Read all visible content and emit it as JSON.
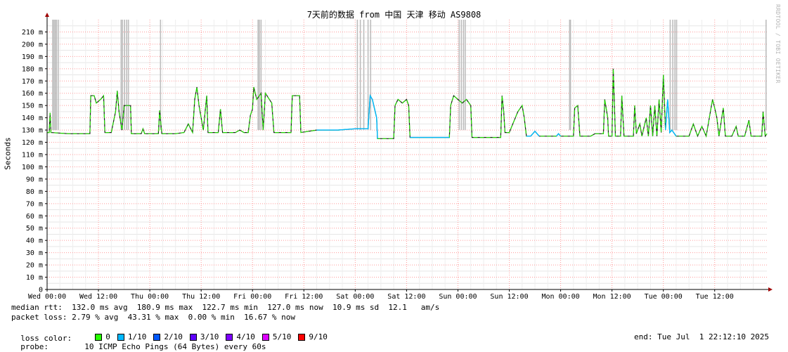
{
  "title": "7天前的数据 from 中国 天津 移动 AS9808",
  "watermark": "RRDTOOL / TOBI OETIKER",
  "chart_data": {
    "type": "line",
    "title": "7天前的数据 from 中国 天津 移动 AS9808",
    "ylabel": "Seconds",
    "ylim": [
      0,
      220
    ],
    "yticks": [
      {
        "v": 0,
        "label": "0"
      },
      {
        "v": 10,
        "label": "10 m"
      },
      {
        "v": 20,
        "label": "20 m"
      },
      {
        "v": 30,
        "label": "30 m"
      },
      {
        "v": 40,
        "label": "40 m"
      },
      {
        "v": 50,
        "label": "50 m"
      },
      {
        "v": 60,
        "label": "60 m"
      },
      {
        "v": 70,
        "label": "70 m"
      },
      {
        "v": 80,
        "label": "80 m"
      },
      {
        "v": 90,
        "label": "90 m"
      },
      {
        "v": 100,
        "label": "100 m"
      },
      {
        "v": 110,
        "label": "110 m"
      },
      {
        "v": 120,
        "label": "120 m"
      },
      {
        "v": 130,
        "label": "130 m"
      },
      {
        "v": 140,
        "label": "140 m"
      },
      {
        "v": 150,
        "label": "150 m"
      },
      {
        "v": 160,
        "label": "160 m"
      },
      {
        "v": 170,
        "label": "170 m"
      },
      {
        "v": 180,
        "label": "180 m"
      },
      {
        "v": 190,
        "label": "190 m"
      },
      {
        "v": 200,
        "label": "200 m"
      },
      {
        "v": 210,
        "label": "210 m"
      }
    ],
    "xlim": [
      0,
      168.2
    ],
    "xticks": [
      {
        "h": 0,
        "label": "Wed 00:00"
      },
      {
        "h": 12,
        "label": "Wed 12:00"
      },
      {
        "h": 24,
        "label": "Thu 00:00"
      },
      {
        "h": 36,
        "label": "Thu 12:00"
      },
      {
        "h": 48,
        "label": "Fri 00:00"
      },
      {
        "h": 60,
        "label": "Fri 12:00"
      },
      {
        "h": 72,
        "label": "Sat 00:00"
      },
      {
        "h": 84,
        "label": "Sat 12:00"
      },
      {
        "h": 96,
        "label": "Sun 00:00"
      },
      {
        "h": 108,
        "label": "Sun 12:00"
      },
      {
        "h": 120,
        "label": "Mon 00:00"
      },
      {
        "h": 132,
        "label": "Mon 12:00"
      },
      {
        "h": 144,
        "label": "Tue 00:00"
      },
      {
        "h": 156,
        "label": "Tue 12:00"
      }
    ],
    "median_rtt": [
      [
        0,
        128
      ],
      [
        0.5,
        128
      ],
      [
        0.7,
        144
      ],
      [
        0.9,
        128
      ],
      [
        5,
        127
      ],
      [
        10,
        127
      ],
      [
        10.2,
        158
      ],
      [
        11,
        158
      ],
      [
        11.5,
        152
      ],
      [
        12.5,
        155
      ],
      [
        13.2,
        158
      ],
      [
        13.5,
        128
      ],
      [
        15,
        128
      ],
      [
        16,
        145
      ],
      [
        16.4,
        162
      ],
      [
        16.8,
        145
      ],
      [
        17.5,
        130
      ],
      [
        18,
        150
      ],
      [
        19.5,
        150
      ],
      [
        19.7,
        127
      ],
      [
        22,
        127
      ],
      [
        22.4,
        131
      ],
      [
        22.8,
        127
      ],
      [
        26,
        127
      ],
      [
        26.3,
        146
      ],
      [
        26.8,
        127
      ],
      [
        30,
        127
      ],
      [
        32,
        128
      ],
      [
        33,
        135
      ],
      [
        34,
        128
      ],
      [
        34.5,
        155
      ],
      [
        35,
        165
      ],
      [
        35.5,
        150
      ],
      [
        36.5,
        130
      ],
      [
        37.3,
        158
      ],
      [
        37.6,
        128
      ],
      [
        40,
        128
      ],
      [
        40.5,
        147
      ],
      [
        41,
        128
      ],
      [
        44,
        128
      ],
      [
        45,
        130
      ],
      [
        46,
        128
      ],
      [
        47,
        128
      ],
      [
        47.5,
        142
      ],
      [
        48,
        147
      ],
      [
        48.3,
        165
      ],
      [
        49,
        155
      ],
      [
        50,
        160
      ],
      [
        50.5,
        130
      ],
      [
        51,
        160
      ],
      [
        52.5,
        152
      ],
      [
        53,
        128
      ],
      [
        57,
        128
      ],
      [
        57.3,
        158
      ],
      [
        59,
        158
      ],
      [
        59.3,
        128
      ],
      [
        63,
        130
      ],
      [
        68,
        130
      ],
      [
        72,
        131
      ],
      [
        75,
        131
      ],
      [
        75.5,
        158
      ],
      [
        76,
        155
      ],
      [
        77,
        140
      ],
      [
        77.2,
        123
      ],
      [
        81,
        123
      ],
      [
        81.3,
        150
      ],
      [
        82,
        155
      ],
      [
        83,
        152
      ],
      [
        84,
        155
      ],
      [
        84.5,
        150
      ],
      [
        84.8,
        124
      ],
      [
        92,
        124
      ],
      [
        94,
        124
      ],
      [
        94.3,
        150
      ],
      [
        95,
        158
      ],
      [
        96,
        155
      ],
      [
        97,
        152
      ],
      [
        98,
        155
      ],
      [
        99,
        150
      ],
      [
        99.3,
        124
      ],
      [
        105,
        124
      ],
      [
        106,
        124
      ],
      [
        106.3,
        158
      ],
      [
        106.7,
        145
      ],
      [
        107,
        128
      ],
      [
        108,
        128
      ],
      [
        110,
        145
      ],
      [
        111,
        150
      ],
      [
        111.5,
        140
      ],
      [
        112,
        125
      ],
      [
        113,
        125
      ],
      [
        114,
        129
      ],
      [
        115,
        125
      ],
      [
        119,
        125
      ],
      [
        119.5,
        127
      ],
      [
        120,
        125
      ],
      [
        123,
        125
      ],
      [
        123.3,
        148
      ],
      [
        124,
        150
      ],
      [
        124.5,
        125
      ],
      [
        127,
        125
      ],
      [
        128,
        127
      ],
      [
        130,
        127
      ],
      [
        130.3,
        155
      ],
      [
        131,
        140
      ],
      [
        131.2,
        125
      ],
      [
        132,
        125
      ],
      [
        132.3,
        180
      ],
      [
        132.8,
        125
      ],
      [
        134,
        125
      ],
      [
        134.3,
        158
      ],
      [
        134.8,
        125
      ],
      [
        137,
        125
      ],
      [
        137.3,
        150
      ],
      [
        137.7,
        127
      ],
      [
        138.5,
        135
      ],
      [
        139,
        125
      ],
      [
        140,
        140
      ],
      [
        140.5,
        125
      ],
      [
        141,
        150
      ],
      [
        141.5,
        125
      ],
      [
        142,
        150
      ],
      [
        142.5,
        125
      ],
      [
        143,
        155
      ],
      [
        143.5,
        128
      ],
      [
        144,
        175
      ],
      [
        144.5,
        130
      ],
      [
        145,
        155
      ],
      [
        145.5,
        128
      ],
      [
        146,
        130
      ],
      [
        147,
        125
      ],
      [
        150,
        125
      ],
      [
        151,
        135
      ],
      [
        152,
        125
      ],
      [
        153,
        133
      ],
      [
        154,
        125
      ],
      [
        155,
        145
      ],
      [
        155.5,
        155
      ],
      [
        156,
        148
      ],
      [
        156.5,
        140
      ],
      [
        157,
        125
      ],
      [
        158,
        148
      ],
      [
        158.5,
        125
      ],
      [
        160,
        125
      ],
      [
        161,
        133
      ],
      [
        161.5,
        125
      ],
      [
        163,
        125
      ],
      [
        164,
        138
      ],
      [
        164.5,
        125
      ],
      [
        167,
        125
      ],
      [
        167.3,
        145
      ],
      [
        167.8,
        125
      ],
      [
        168.2,
        127
      ]
    ],
    "loss_color_legend": [
      "0",
      "1/10",
      "2/10",
      "3/10",
      "4/10",
      "5/10",
      "9/10"
    ],
    "loss_colors": [
      "#26ff00",
      "#00b8ff",
      "#0059ff",
      "#5e00ff",
      "#7e00ff",
      "#dd00ff",
      "#ff0000"
    ],
    "loss_events_h": [
      1.3,
      1.6,
      1.9,
      2.2,
      2.6,
      17.3,
      17.6,
      18.1,
      18.6,
      19.0,
      26.5,
      49.3,
      49.6,
      50.0,
      72.5,
      73.2,
      74.0,
      75.0,
      75.6,
      96.3,
      96.8,
      97.3,
      97.7,
      122.1,
      122.3,
      145.6,
      146.2,
      146.7,
      147.1,
      168.0
    ]
  },
  "legend": {
    "median_rtt": "median rtt:  132.0 ms avg  180.9 ms max  122.7 ms min  127.0 ms now  10.9 ms sd  12.1   am/s",
    "packet_loss": "packet loss: 2.79 % avg  43.31 % max  0.00 % min  16.67 % now",
    "loss_color_label": "loss color:",
    "probe_label": "probe:",
    "probe_value": "10 ICMP Echo Pings (64 Bytes) every 60s",
    "end": "end: Tue Jul  1 22:12:10 2025"
  }
}
